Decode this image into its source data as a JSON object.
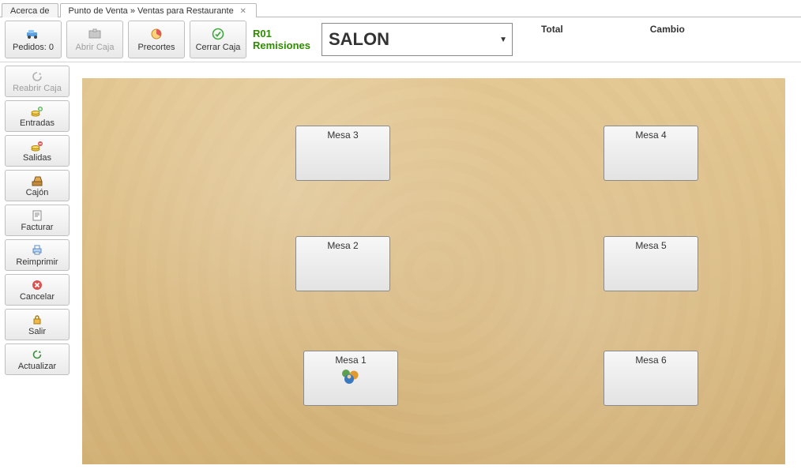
{
  "tabs": {
    "t0": "Acerca de",
    "t1": "Punto de Venta » Ventas para Restaurante"
  },
  "toolbar": {
    "pedidos_label": "Pedidos: 0",
    "abrir_caja_label": "Abrir Caja",
    "precortes_label": "Precortes",
    "cerrar_caja_label": "Cerrar Caja"
  },
  "remision": {
    "code": "R01",
    "label": "Remisiones"
  },
  "salon": {
    "selected": "SALON"
  },
  "totals": {
    "total_label": "Total",
    "cambio_label": "Cambio"
  },
  "sidebar": {
    "reabrir_caja": "Reabrir Caja",
    "entradas": "Entradas",
    "salidas": "Salidas",
    "cajon": "Cajón",
    "facturar": "Facturar",
    "reimprimir": "Reimprimir",
    "cancelar": "Cancelar",
    "salir": "Salir",
    "actualizar": "Actualizar"
  },
  "mesas": {
    "m1": "Mesa 1",
    "m2": "Mesa 2",
    "m3": "Mesa 3",
    "m4": "Mesa 4",
    "m5": "Mesa 5",
    "m6": "Mesa 6"
  }
}
